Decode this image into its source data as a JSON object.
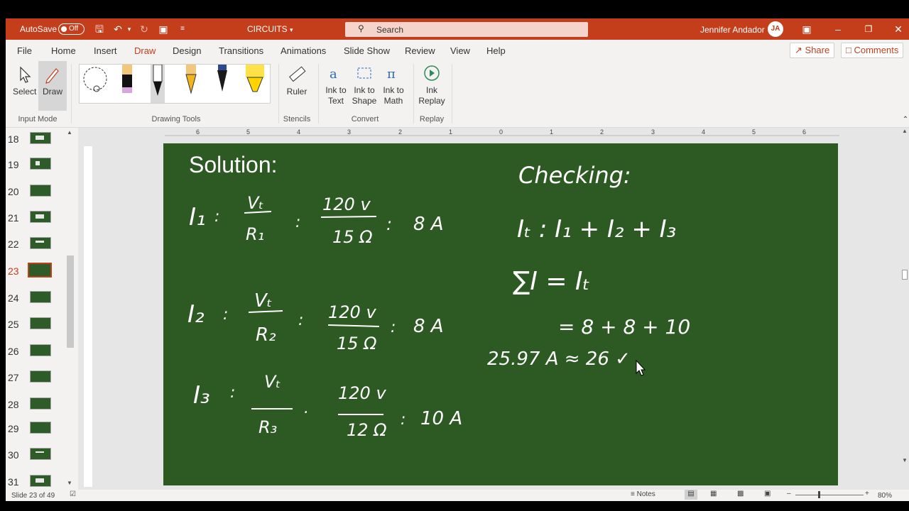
{
  "titlebar": {
    "autosave_label": "AutoSave",
    "autosave_state": "Off",
    "document_title": "CIRCUITS",
    "search_placeholder": "Search",
    "user_name": "Jennifer Andador",
    "user_initials": "JA",
    "accent_color": "#c43e1c"
  },
  "menu": {
    "items": [
      "File",
      "Home",
      "Insert",
      "Draw",
      "Design",
      "Transitions",
      "Animations",
      "Slide Show",
      "Review",
      "View",
      "Help"
    ],
    "active": "Draw",
    "share_label": "Share",
    "comments_label": "Comments"
  },
  "ribbon": {
    "select_label": "Select",
    "draw_label": "Draw",
    "input_mode_label": "Input Mode",
    "drawing_tools_label": "Drawing Tools",
    "ruler_label": "Ruler",
    "stencils_label": "Stencils",
    "ink_to_text_label": [
      "Ink to",
      "Text"
    ],
    "ink_to_shape_label": [
      "Ink to",
      "Shape"
    ],
    "ink_to_math_label": [
      "Ink to",
      "Math"
    ],
    "convert_label": "Convert",
    "ink_replay_label": [
      "Ink",
      "Replay"
    ],
    "replay_label": "Replay"
  },
  "thumbnails": {
    "numbers": [
      "18",
      "19",
      "20",
      "21",
      "22",
      "23",
      "24",
      "25",
      "26",
      "27",
      "28",
      "29",
      "30",
      "31"
    ],
    "active": "23"
  },
  "ruler": {
    "ticks": [
      "6",
      "5",
      "4",
      "3",
      "2",
      "1",
      "0",
      "1",
      "2",
      "3",
      "4",
      "5",
      "6"
    ]
  },
  "slide": {
    "heading": "Solution:",
    "background": "#2d5923",
    "handwriting": {
      "i1_left": "I₁",
      "i1_num": "Vₜ",
      "i1_den": "R₁",
      "i1_value_num": "120 v",
      "i1_value_den": "15 Ω",
      "i1_result": "8 A",
      "i2_left": "I₂",
      "i2_num": "Vₜ",
      "i2_den": "R₂",
      "i2_value_num": "120 v",
      "i2_value_den": "15 Ω",
      "i2_result": "8 A",
      "i3_left": "I₃",
      "i3_num": "Vₜ",
      "i3_den": "R₃",
      "i3_value_num": "120 v",
      "i3_value_den": "12 Ω",
      "i3_result": "10 A",
      "checking": "Checking:",
      "sum_line": "Iₜ : I₁ + I₂ + I₃",
      "sigma_line": "∑I = Iₜ",
      "numbers_line": "= 8 + 8 + 10",
      "approx_line": "25.97 A ≈ 26 ✓"
    }
  },
  "status": {
    "slide_info": "Slide 23 of 49",
    "notes_label": "Notes",
    "zoom": "80%"
  }
}
